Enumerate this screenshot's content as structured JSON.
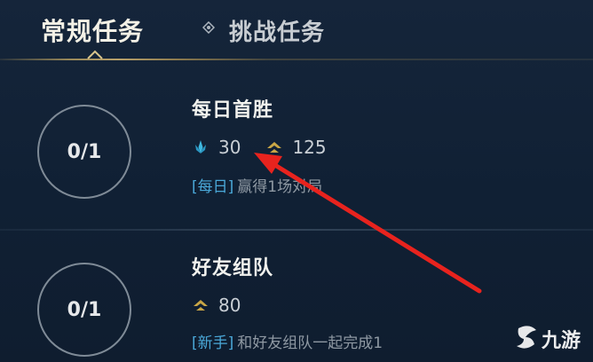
{
  "tabs": {
    "active_label": "常规任务",
    "inactive_label": "挑战任务"
  },
  "tasks": [
    {
      "progress": "0/1",
      "title": "每日首胜",
      "rewards": [
        {
          "icon": "blue-crystal-icon",
          "value": "30"
        },
        {
          "icon": "gold-chevron-icon",
          "value": "125"
        }
      ],
      "tag": "[每日]",
      "description": "赢得1场对局"
    },
    {
      "progress": "0/1",
      "title": "好友组队",
      "rewards": [
        {
          "icon": "gold-chevron-icon",
          "value": "80"
        }
      ],
      "tag": "[新手]",
      "description": "和好友组队一起完成1"
    }
  ],
  "watermark": {
    "logo_icon": "jiuyou-logo-icon",
    "text": "九游"
  },
  "colors": {
    "accent_gold": "#c9a646",
    "crystal_blue": "#3fb8e0",
    "tag_blue": "#4aa8d8",
    "annotation_red": "#e8231e"
  }
}
